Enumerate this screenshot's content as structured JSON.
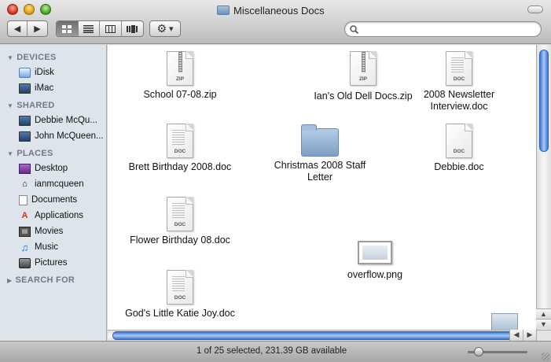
{
  "window": {
    "title": "Miscellaneous Docs"
  },
  "toolbar": {
    "back": "◀",
    "forward": "▶",
    "views": [
      "icon-view",
      "list-view",
      "column-view",
      "coverflow-view"
    ],
    "action": "⚙",
    "action_caret": "▾",
    "search_placeholder": ""
  },
  "sidebar": {
    "devices_header": "DEVICES",
    "devices": [
      "iDisk",
      "iMac"
    ],
    "shared_header": "SHARED",
    "shared": [
      "Debbie McQu...",
      "John McQueen..."
    ],
    "places_header": "PLACES",
    "places": [
      "Desktop",
      "ianmcqueen",
      "Documents",
      "Applications",
      "Movies",
      "Music",
      "Pictures"
    ],
    "search_header": "SEARCH FOR"
  },
  "files": [
    {
      "name": "School 07-08.zip",
      "kind": "zip",
      "tag": "ZIP"
    },
    {
      "name": "Ian's Old Dell Docs.zip",
      "kind": "zip",
      "tag": "ZIP"
    },
    {
      "name": "2008 Newsletter Interview.doc",
      "kind": "doc",
      "tag": "DOC"
    },
    {
      "name": "Brett Birthday 2008.doc",
      "kind": "doc",
      "tag": "DOC"
    },
    {
      "name": "Christmas 2008 Staff Letter",
      "kind": "folder",
      "tag": ""
    },
    {
      "name": "Debbie.doc",
      "kind": "doc",
      "tag": "DOC"
    },
    {
      "name": "Flower Birthday 08.doc",
      "kind": "doc",
      "tag": "DOC"
    },
    {
      "name": "overflow.png",
      "kind": "png",
      "tag": ""
    },
    {
      "name": "God's Little Katie Joy.doc",
      "kind": "doc",
      "tag": "DOC"
    },
    {
      "name": "",
      "kind": "thumb",
      "tag": ""
    }
  ],
  "scroll": {
    "up": "▲",
    "down": "▼",
    "left": "◀",
    "right": "▶"
  },
  "status": {
    "text": "1 of 25 selected, 231.39 GB available",
    "icon_size": 0.12
  },
  "colors": {
    "sidebar_bg": "#dde4ec",
    "sidebar_header": "#6d7a88",
    "scroll_accent": "#3a76d8"
  }
}
